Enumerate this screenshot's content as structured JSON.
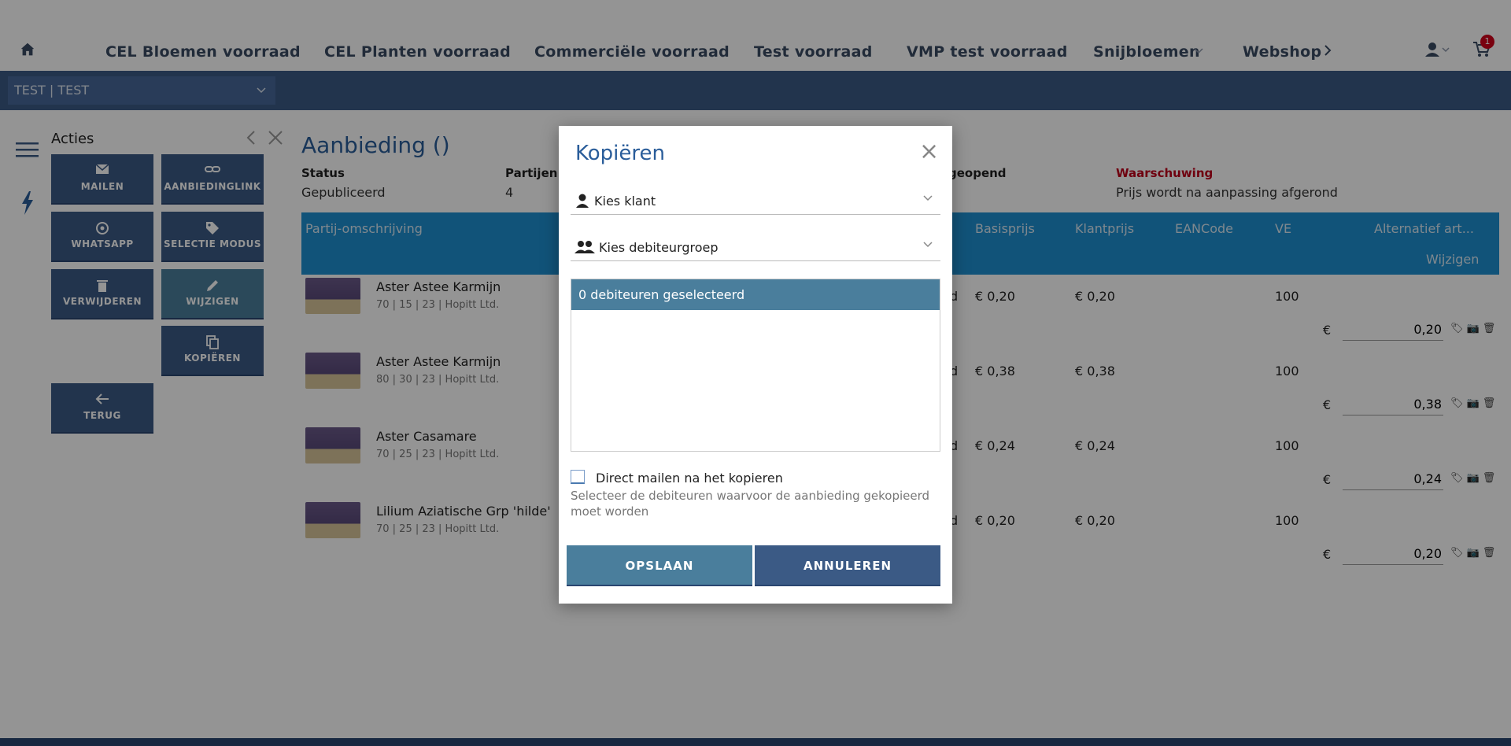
{
  "nav": {
    "items": [
      "CEL Bloemen voorraad",
      "CEL Planten voorraad",
      "Commerciële voorraad",
      "Test voorraad",
      "VMP test voorraad",
      "Snijbloemen",
      "Webshop"
    ],
    "cart_count": "1"
  },
  "debtor": {
    "value": "TEST | TEST"
  },
  "sidebar": {
    "title": "Acties",
    "buttons": {
      "mailen": "MAILEN",
      "aanbiedinglink": "AANBIEDINGLINK",
      "whatsapp": "WHATSAPP",
      "selectie": "SELECTIE MODUS",
      "verwijderen": "VERWIJDEREN",
      "wijzigen": "WIJZIGEN",
      "kopieren": "KOPIËREN",
      "terug": "TERUG"
    }
  },
  "page": {
    "title": "Aanbieding ()",
    "status_label": "Status",
    "status_value": "Gepubliceerd",
    "partijen_label": "Partijen",
    "partijen_value": "4",
    "geopend_label": "geopend",
    "warning_label": "Waarschuwing",
    "warning_value": "Prijs wordt na aanpassing afgerond"
  },
  "table": {
    "headers": {
      "omschrijving": "Partij-omschrijving",
      "basisprijs": "Basisprijs",
      "klantprijs": "Klantprijs",
      "eancode": "EANCode",
      "ve": "VE",
      "alternatief": "Alternatief art...",
      "wijzigen": "Wijzigen"
    },
    "rows": [
      {
        "name": "Aster Astee Karmijn",
        "sub": "70 | 15 | 23 | Hopitt Ltd.",
        "partial": "d",
        "basisprijs": "€ 0,20",
        "klantprijs": "€ 0,20",
        "ve": "100",
        "euro": "€",
        "price": "0,20"
      },
      {
        "name": "Aster Astee Karmijn",
        "sub": "80 | 30 | 23 | Hopitt Ltd.",
        "partial": "d",
        "basisprijs": "€ 0,38",
        "klantprijs": "€ 0,38",
        "ve": "100",
        "euro": "€",
        "price": "0,38"
      },
      {
        "name": "Aster Casamare",
        "sub": "70 | 25 | 23 | Hopitt Ltd.",
        "partial": "d",
        "basisprijs": "€ 0,24",
        "klantprijs": "€ 0,24",
        "ve": "100",
        "euro": "€",
        "price": "0,24"
      },
      {
        "name": "Lilium Aziatische Grp 'hilde'",
        "sub": "70 | 25 | 23 | Hopitt Ltd.",
        "partial": "d",
        "basisprijs": "€ 0,20",
        "klantprijs": "€ 0,20",
        "ve": "100",
        "euro": "€",
        "price": "0,20"
      }
    ]
  },
  "modal": {
    "title": "Kopiëren",
    "klant_placeholder": "Kies klant",
    "groep_placeholder": "Kies debiteurgroep",
    "selected_header": "0 debiteuren geselecteerd",
    "checkbox_label": "Direct mailen na het kopieren",
    "help_text": "Selecteer de debiteuren waarvoor de aanbieding gekopieerd moet worden",
    "save_label": "OPSLAAN",
    "cancel_label": "ANNULEREN"
  }
}
